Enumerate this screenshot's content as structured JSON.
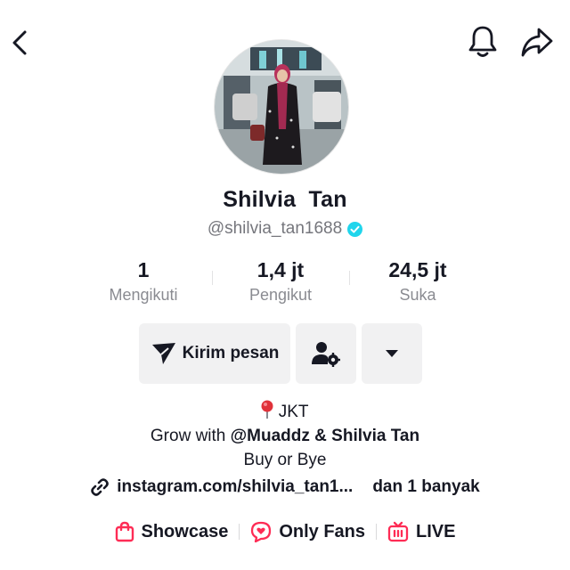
{
  "profile": {
    "name": "Shilvia  Tan",
    "handle": "@shilvia_tan1688",
    "verified": true
  },
  "stats": [
    {
      "value": "1",
      "label": "Mengikuti"
    },
    {
      "value": "1,4 jt",
      "label": "Pengikut"
    },
    {
      "value": "24,5 jt",
      "label": "Suka"
    }
  ],
  "actions": {
    "message_label": "Kirim pesan"
  },
  "bio": {
    "location": "JKT",
    "grow_prefix": "Grow with ",
    "grow_mention": "@Muaddz & Shilvia Tan",
    "line3": "Buy or Bye"
  },
  "link": {
    "text": "instagram.com/shilvia_tan1...",
    "more": "dan 1 banyak"
  },
  "features": [
    {
      "label": "Showcase",
      "icon": "shopping-bag-icon"
    },
    {
      "label": "Only Fans",
      "icon": "chat-heart-icon"
    },
    {
      "label": "LIVE",
      "icon": "tv-icon"
    }
  ],
  "colors": {
    "accent": "#fe2c55",
    "verified": "#20d5ec",
    "text": "#161823",
    "muted": "#8a8b91",
    "button_bg": "#f1f1f2"
  }
}
